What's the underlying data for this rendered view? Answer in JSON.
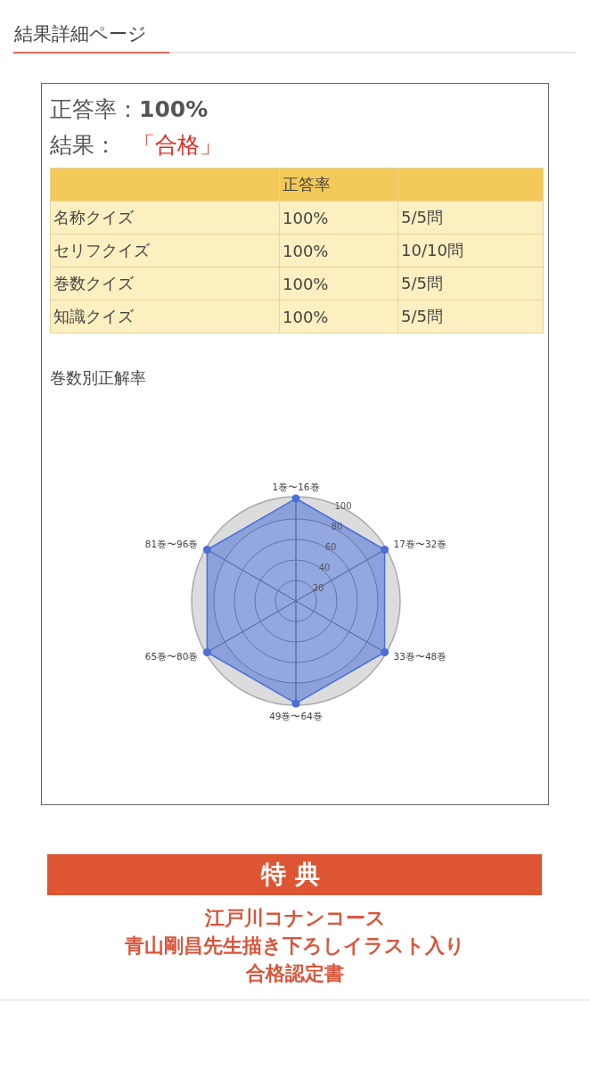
{
  "page_title": "結果詳細ページ",
  "summary": {
    "rate_label": "正答率：",
    "rate_value": "100%",
    "result_label": "結果：",
    "result_value": "「合格」"
  },
  "table": {
    "header": {
      "column_2": "正答率"
    },
    "rows": [
      {
        "name": "名称クイズ",
        "rate": "100%",
        "count": "5/5問"
      },
      {
        "name": "セリフクイズ",
        "rate": "100%",
        "count": "10/10問"
      },
      {
        "name": "巻数クイズ",
        "rate": "100%",
        "count": "5/5問"
      },
      {
        "name": "知識クイズ",
        "rate": "100%",
        "count": "5/5問"
      }
    ]
  },
  "chart_heading": "巻数別正解率",
  "radar": {
    "axes": [
      "1巻〜16巻",
      "17巻〜32巻",
      "33巻〜48巻",
      "49巻〜64巻",
      "65巻〜80巻",
      "81巻〜96巻"
    ],
    "ring_labels": [
      "20",
      "40",
      "60",
      "80",
      "100"
    ]
  },
  "bonus": {
    "heading": "特典",
    "lines": [
      "江戸川コナンコース",
      "青山剛昌先生描き下ろしイラスト入り",
      "合格認定書"
    ]
  }
}
